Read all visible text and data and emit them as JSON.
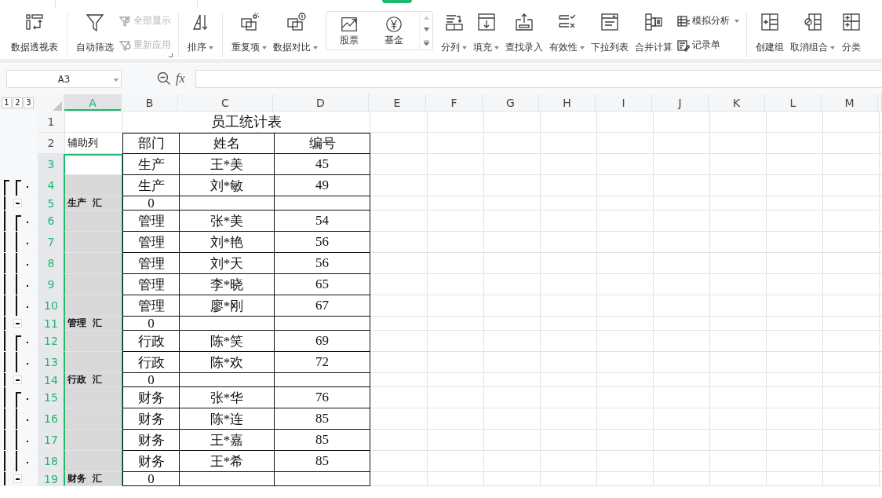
{
  "ribbon": {
    "items": [
      {
        "kind": "large",
        "label": "数据透视表",
        "dropdown": false
      },
      {
        "kind": "separator"
      },
      {
        "kind": "large",
        "label": "自动筛选",
        "dropdown": false
      },
      {
        "kind": "pair",
        "items": [
          {
            "label": "全部显示",
            "dropdown": false,
            "disabled": true
          },
          {
            "label": "重新应用",
            "dropdown": false,
            "disabled": true
          }
        ]
      },
      {
        "kind": "separator"
      },
      {
        "kind": "large",
        "label": "排序",
        "dropdown": true
      },
      {
        "kind": "separator"
      },
      {
        "kind": "large",
        "label": "重复项",
        "dropdown": true
      },
      {
        "kind": "large",
        "label": "数据对比",
        "dropdown": true
      },
      {
        "kind": "panel",
        "items": [
          {
            "label": "股票"
          },
          {
            "label": "基金"
          }
        ]
      },
      {
        "kind": "large",
        "label": "分列",
        "dropdown": true
      },
      {
        "kind": "large",
        "label": "填充",
        "dropdown": true
      },
      {
        "kind": "large",
        "label": "查找录入",
        "dropdown": false
      },
      {
        "kind": "large",
        "label": "有效性",
        "dropdown": true
      },
      {
        "kind": "large",
        "label": "下拉列表",
        "dropdown": false
      },
      {
        "kind": "large",
        "label": "合并计算",
        "dropdown": false
      },
      {
        "kind": "pair",
        "items": [
          {
            "label": "模拟分析",
            "dropdown": true,
            "disabled": false
          },
          {
            "label": "记录单",
            "dropdown": false,
            "disabled": false
          }
        ]
      },
      {
        "kind": "separator"
      },
      {
        "kind": "large",
        "label": "创建组",
        "dropdown": false
      },
      {
        "kind": "large",
        "label": "取消组合",
        "dropdown": true
      },
      {
        "kind": "large",
        "label": "分类",
        "dropdown": false
      }
    ]
  },
  "formula_bar": {
    "cell_reference": "A3",
    "function_label": "fx"
  },
  "outline_levels": [
    "1",
    "2",
    "3"
  ],
  "columns": [
    {
      "letter": "A",
      "selected": true
    },
    {
      "letter": "B",
      "selected": false
    },
    {
      "letter": "C",
      "selected": false
    },
    {
      "letter": "D",
      "selected": false
    },
    {
      "letter": "E",
      "selected": false
    },
    {
      "letter": "F",
      "selected": false
    },
    {
      "letter": "G",
      "selected": false
    },
    {
      "letter": "H",
      "selected": false
    },
    {
      "letter": "I",
      "selected": false
    },
    {
      "letter": "J",
      "selected": false
    },
    {
      "letter": "K",
      "selected": false
    },
    {
      "letter": "L",
      "selected": false
    },
    {
      "letter": "M",
      "selected": false
    }
  ],
  "rows": [
    {
      "number": "1",
      "kind": "title",
      "selected": false,
      "title": "员工统计表"
    },
    {
      "number": "2",
      "kind": "header",
      "selected": false,
      "a": "辅助列",
      "b": "部门",
      "c": "姓名",
      "d": "编号"
    },
    {
      "number": "3",
      "kind": "detail",
      "selected": true,
      "b": "生产",
      "c": "王*美",
      "d": "45"
    },
    {
      "number": "4",
      "kind": "detail",
      "selected": true,
      "b": "生产",
      "c": "刘*敏",
      "d": "49"
    },
    {
      "number": "5",
      "kind": "summary",
      "selected": true,
      "a": "生产 汇",
      "b": "0"
    },
    {
      "number": "6",
      "kind": "detail",
      "selected": true,
      "b": "管理",
      "c": "张*美",
      "d": "54"
    },
    {
      "number": "7",
      "kind": "detail",
      "selected": true,
      "b": "管理",
      "c": "刘*艳",
      "d": "56"
    },
    {
      "number": "8",
      "kind": "detail",
      "selected": true,
      "b": "管理",
      "c": "刘*天",
      "d": "56"
    },
    {
      "number": "9",
      "kind": "detail",
      "selected": true,
      "b": "管理",
      "c": "李*晓",
      "d": "65"
    },
    {
      "number": "10",
      "kind": "detail",
      "selected": true,
      "b": "管理",
      "c": "廖*刚",
      "d": "67"
    },
    {
      "number": "11",
      "kind": "summary",
      "selected": true,
      "a": "管理 汇",
      "b": "0"
    },
    {
      "number": "12",
      "kind": "detail",
      "selected": true,
      "b": "行政",
      "c": "陈*笑",
      "d": "69"
    },
    {
      "number": "13",
      "kind": "detail",
      "selected": true,
      "b": "行政",
      "c": "陈*欢",
      "d": "72"
    },
    {
      "number": "14",
      "kind": "summary",
      "selected": true,
      "a": "行政 汇",
      "b": "0"
    },
    {
      "number": "15",
      "kind": "detail",
      "selected": true,
      "b": "财务",
      "c": "张*华",
      "d": "76"
    },
    {
      "number": "16",
      "kind": "detail",
      "selected": true,
      "b": "财务",
      "c": "陈*连",
      "d": "85"
    },
    {
      "number": "17",
      "kind": "detail",
      "selected": true,
      "b": "财务",
      "c": "王*嘉",
      "d": "85"
    },
    {
      "number": "18",
      "kind": "detail",
      "selected": true,
      "b": "财务",
      "c": "王*希",
      "d": "85"
    },
    {
      "number": "19",
      "kind": "summary",
      "selected": true,
      "a": "财务 汇",
      "b": "0"
    }
  ]
}
